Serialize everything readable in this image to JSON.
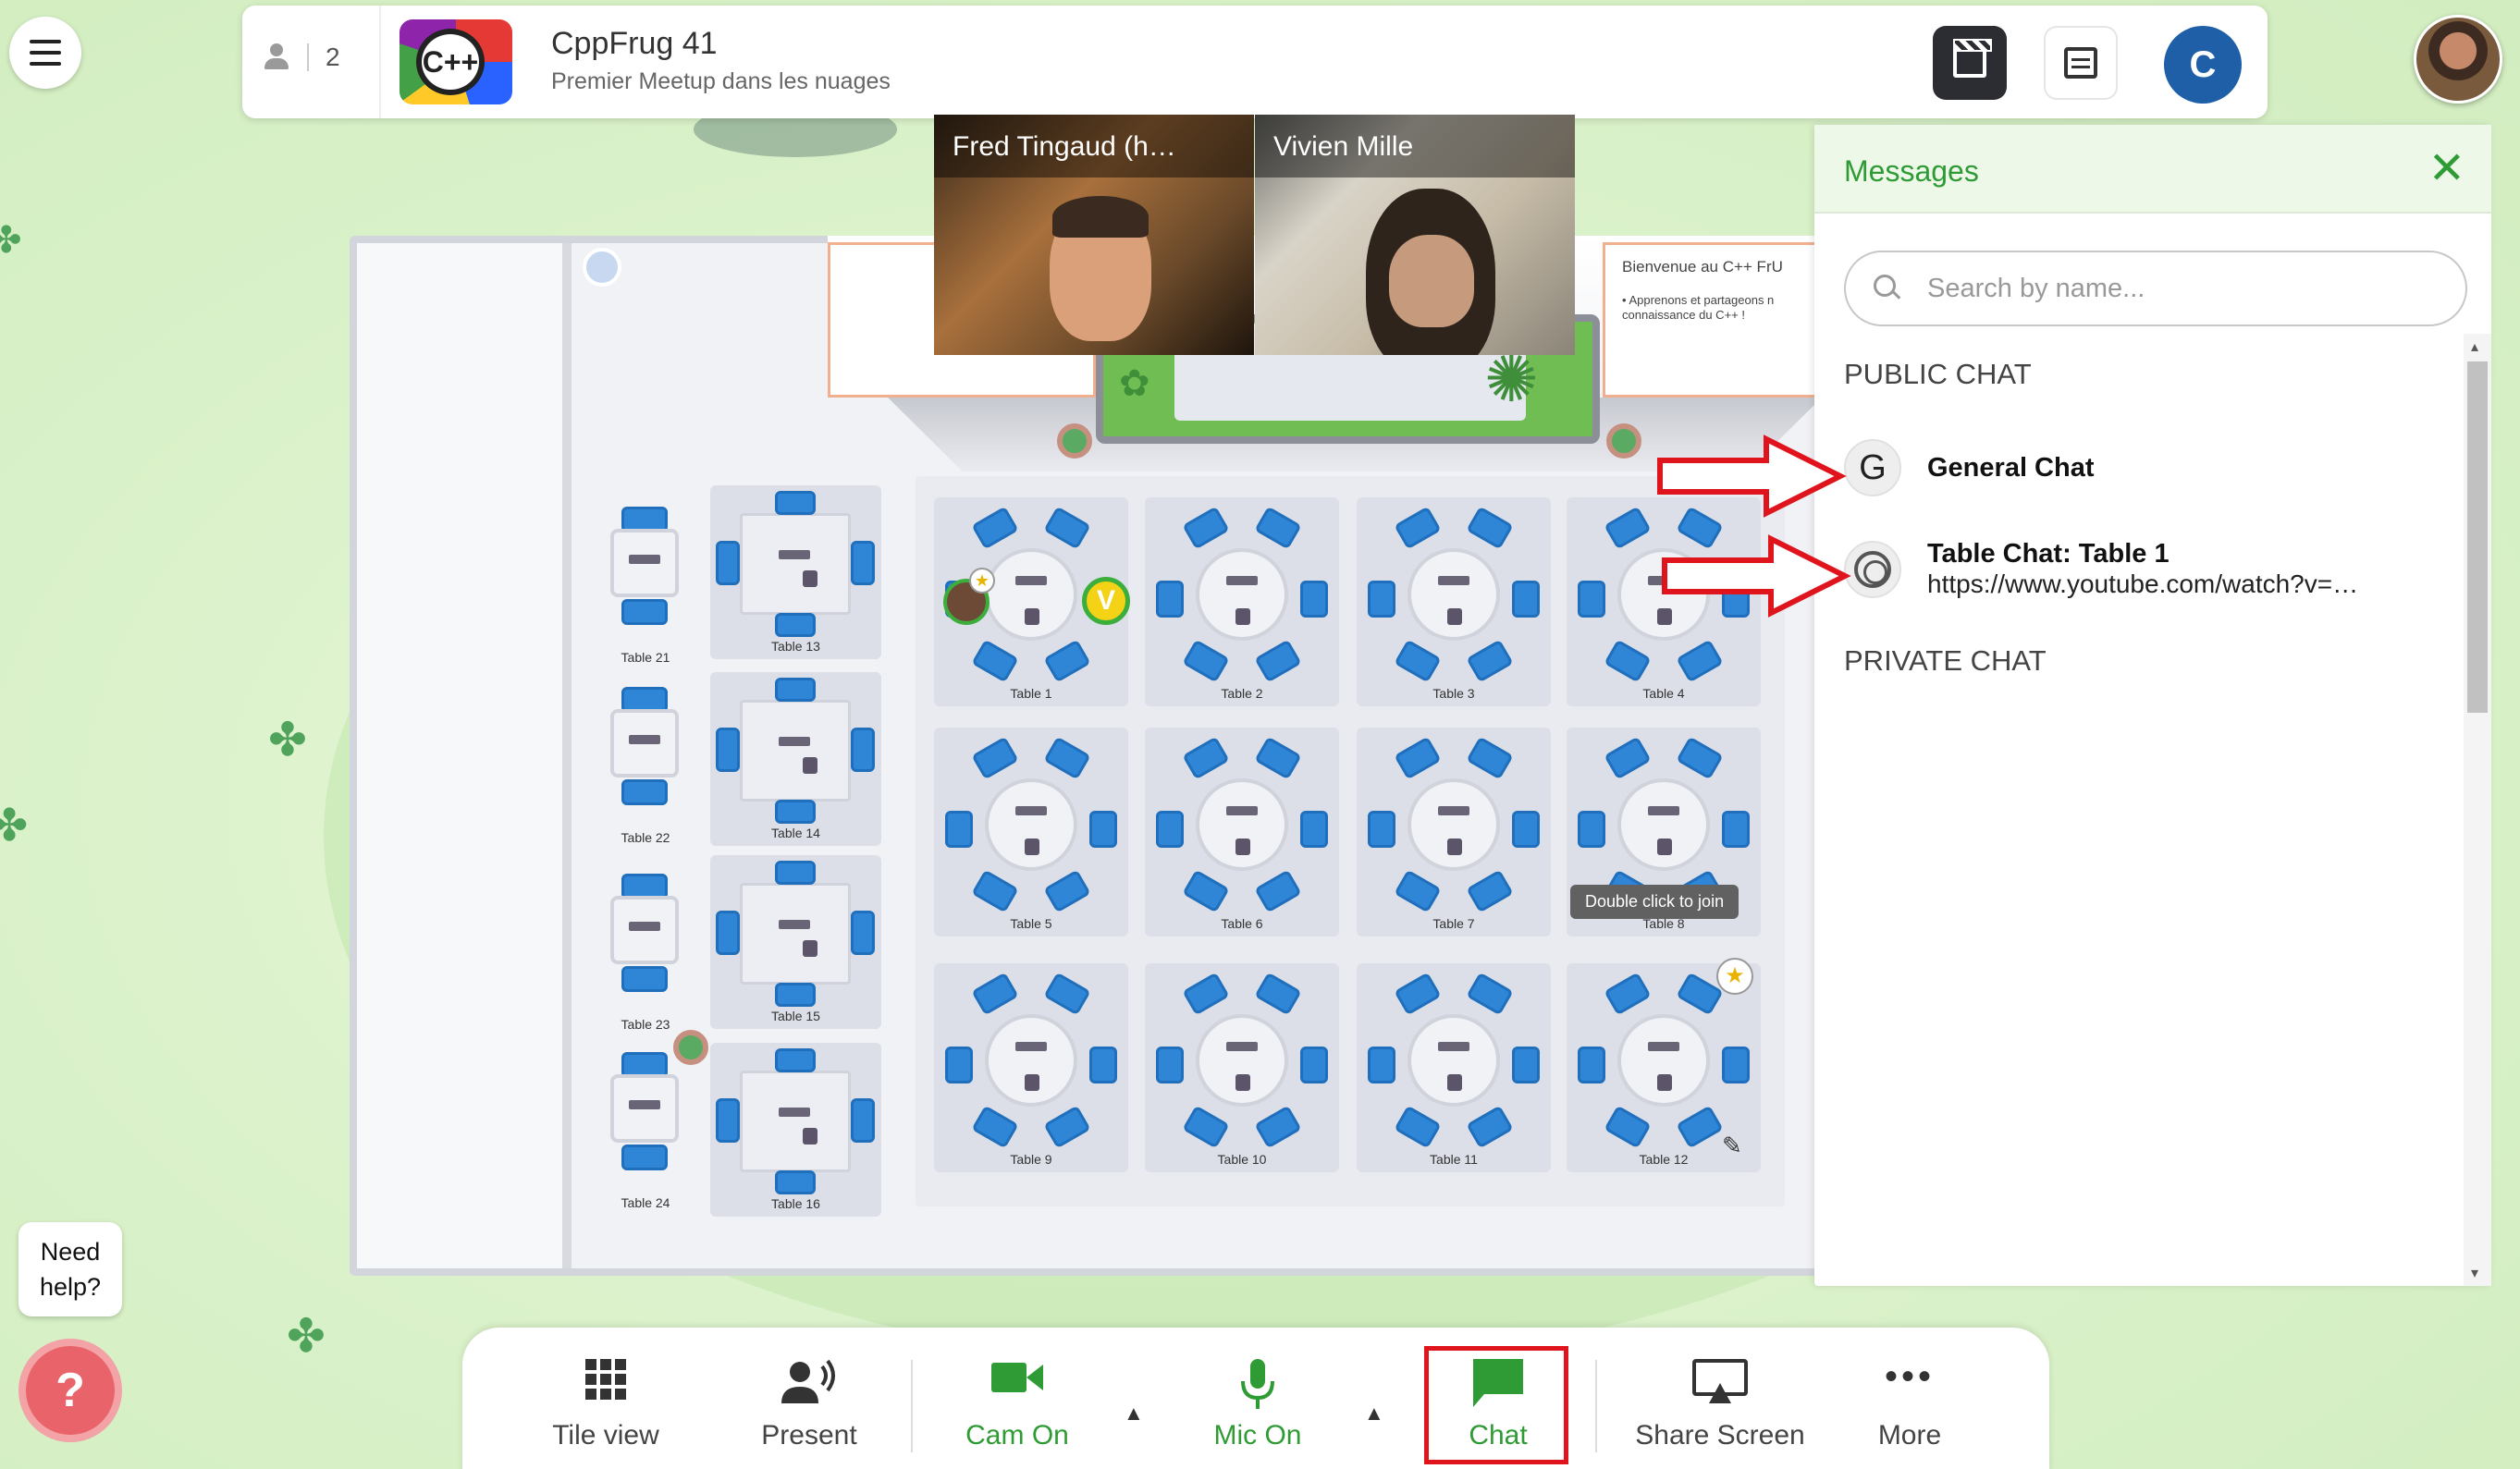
{
  "event": {
    "participant_count": "2",
    "title": "CppFrug 41",
    "subtitle": "Premier Meetup dans les nuages",
    "logo_text": "C++",
    "brand_text": "C"
  },
  "videos": [
    {
      "name": "Fred Tingaud (h…"
    },
    {
      "name": "Vivien Mille"
    }
  ],
  "board": {
    "heading": "Bienvenue au C++ FrU",
    "body": "• Apprenons et partageons n connaissance du C++ !"
  },
  "floor": {
    "tables_left": [
      "Table 21",
      "Table 22",
      "Table 23",
      "Table 24"
    ],
    "tables_square": [
      "Table 13",
      "Table 14",
      "Table 15",
      "Table 16"
    ],
    "tables_round": [
      "Table 1",
      "Table 2",
      "Table 3",
      "Table 4",
      "Table 5",
      "Table 6",
      "Table 7",
      "Table 8",
      "Table 9",
      "Table 10",
      "Table 11",
      "Table 12"
    ],
    "tooltip": "Double click to join",
    "avatar_badge": "V"
  },
  "messages": {
    "title": "Messages",
    "search_placeholder": "Search by name...",
    "public_section": "PUBLIC CHAT",
    "private_section": "PRIVATE CHAT",
    "chats": [
      {
        "avatar": "G",
        "name": "General Chat",
        "preview": ""
      },
      {
        "avatar": "",
        "name": "Table Chat: Table 1",
        "preview": "https://www.youtube.com/watch?v=…"
      }
    ]
  },
  "toolbar": {
    "tile_view": "Tile view",
    "present": "Present",
    "cam": "Cam On",
    "mic": "Mic On",
    "chat": "Chat",
    "share": "Share Screen",
    "more": "More"
  },
  "help": {
    "text": "Need help?",
    "icon": "?"
  },
  "colors": {
    "accent_green": "#2e9b35",
    "highlight_red": "#e0141c",
    "chair_blue": "#2f86d6"
  }
}
